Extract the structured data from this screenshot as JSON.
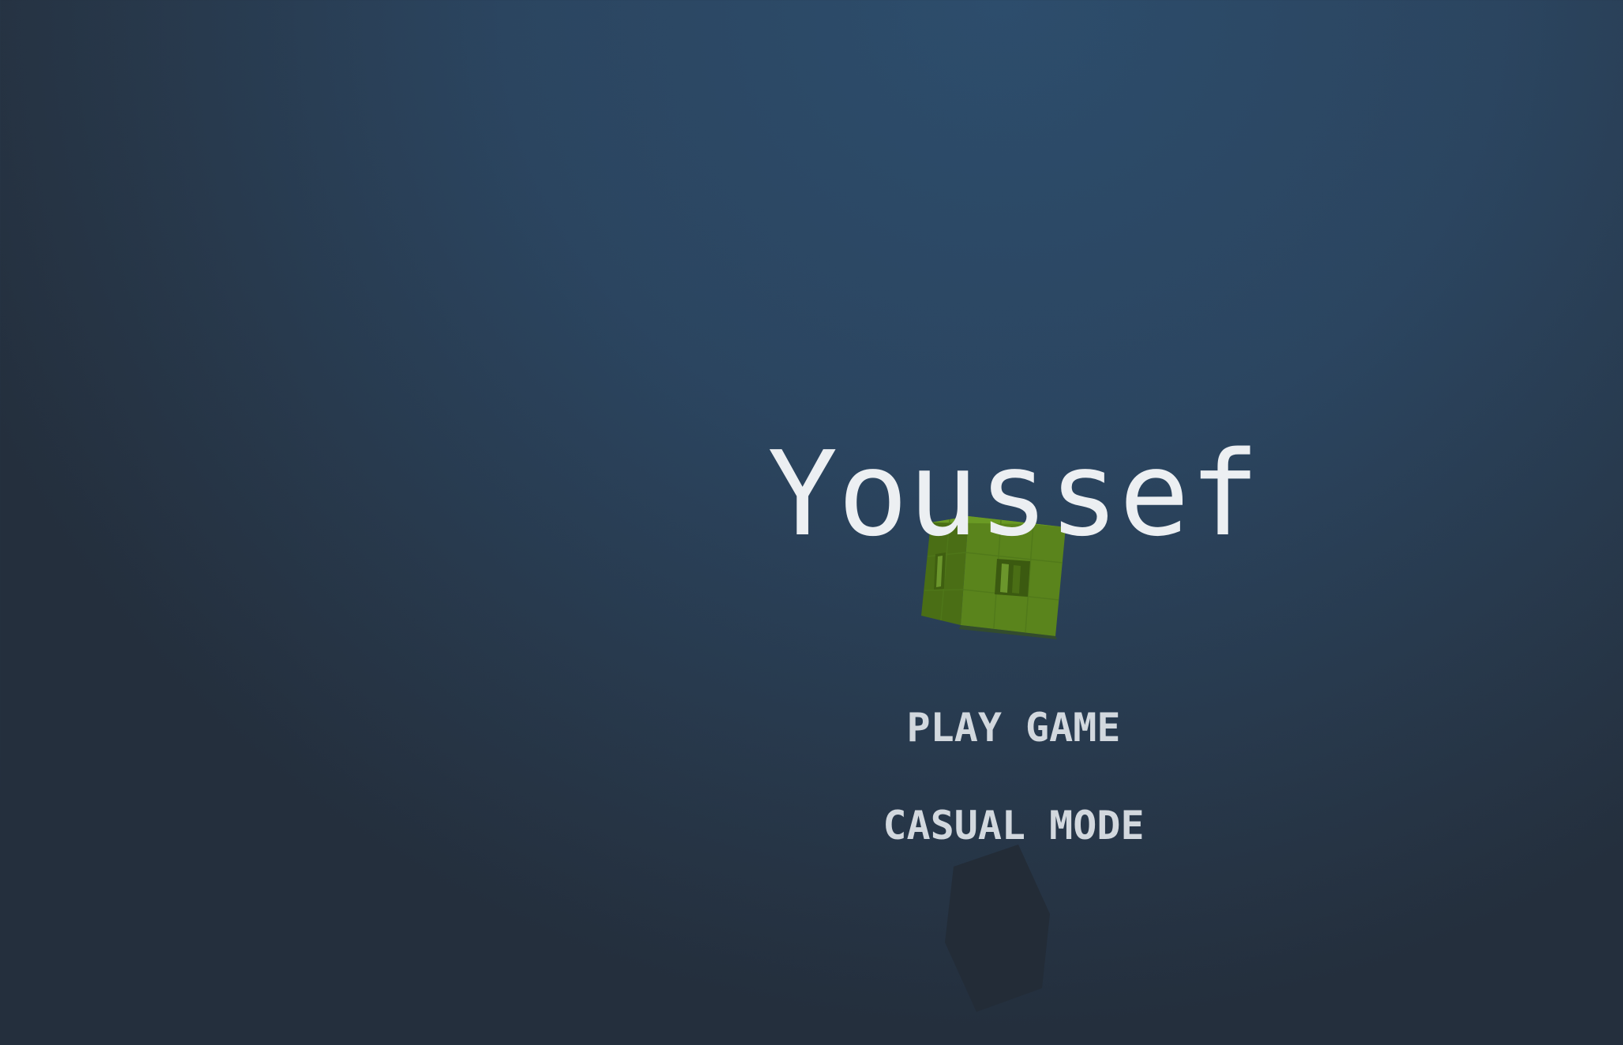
{
  "title": "Youssef",
  "menu": {
    "play_label": "PLAY GAME",
    "casual_label": "CASUAL MODE"
  },
  "decorations": {
    "cube_color": "#5a841c",
    "rock_color": "#232c37"
  },
  "colors": {
    "background": "#2b4560",
    "title_text": "#eceff2",
    "menu_text": "#d2d8de"
  }
}
